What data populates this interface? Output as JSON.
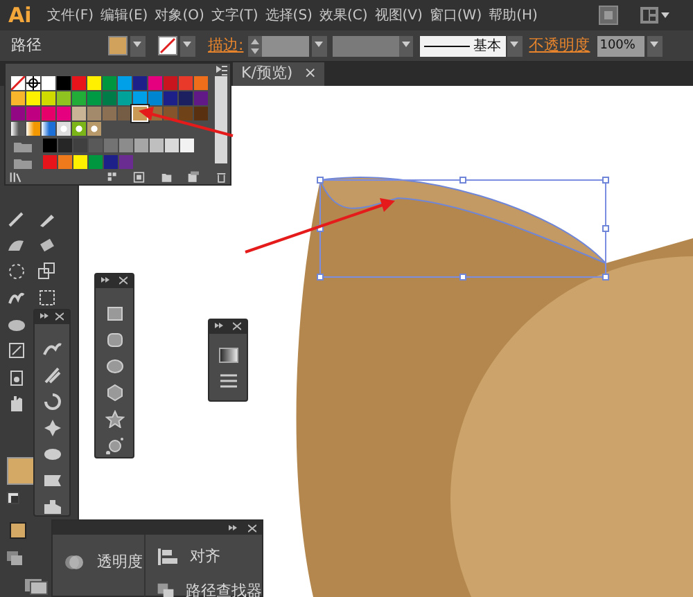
{
  "menu_bar": {
    "logo": "Ai",
    "menus": [
      "文件(F)",
      "编辑(E)",
      "对象(O)",
      "文字(T)",
      "选择(S)",
      "效果(C)",
      "视图(V)",
      "窗口(W)",
      "帮助(H)"
    ]
  },
  "control_bar": {
    "selection_type": "路径",
    "stroke_label": "描边:",
    "stroke_profile": "基本",
    "opacity_label": "不透明度",
    "opacity_value": "100%"
  },
  "document_tab": {
    "title": "K/预览)",
    "close": "×"
  },
  "swatches_panel": {
    "rows": [
      {
        "swatches": [
          {
            "kind": "none",
            "selected": false
          },
          {
            "kind": "registration",
            "selected": false
          },
          {
            "kind": "color",
            "color": "#ffffff",
            "selected": false
          },
          {
            "kind": "color",
            "color": "#000000",
            "selected": false
          },
          {
            "kind": "color",
            "color": "#e8141b",
            "selected": false
          },
          {
            "kind": "color",
            "color": "#fff000",
            "selected": false
          },
          {
            "kind": "color",
            "color": "#00953f",
            "selected": false
          },
          {
            "kind": "color",
            "color": "#00a0e9",
            "selected": false
          },
          {
            "kind": "color",
            "color": "#1d2088",
            "selected": false
          },
          {
            "kind": "color",
            "color": "#e4007f",
            "selected": false
          },
          {
            "kind": "color",
            "color": "#c9151e",
            "selected": false
          },
          {
            "kind": "color",
            "color": "#e8392a",
            "selected": false
          },
          {
            "kind": "color",
            "color": "#ef6e1b",
            "selected": false
          }
        ]
      },
      {
        "swatches": [
          {
            "kind": "color",
            "color": "#f8b62d",
            "selected": false
          },
          {
            "kind": "color",
            "color": "#fff100",
            "selected": false
          },
          {
            "kind": "color",
            "color": "#cfdb00",
            "selected": false
          },
          {
            "kind": "color",
            "color": "#8fc31f",
            "selected": false
          },
          {
            "kind": "color",
            "color": "#22ac38",
            "selected": false
          },
          {
            "kind": "color",
            "color": "#009944",
            "selected": false
          },
          {
            "kind": "color",
            "color": "#007c48",
            "selected": false
          },
          {
            "kind": "color",
            "color": "#00a29a",
            "selected": false
          },
          {
            "kind": "color",
            "color": "#00a0e9",
            "selected": false
          },
          {
            "kind": "color",
            "color": "#0086d1",
            "selected": false
          },
          {
            "kind": "color",
            "color": "#1d2088",
            "selected": false
          },
          {
            "kind": "color",
            "color": "#1d2060",
            "selected": false
          },
          {
            "kind": "color",
            "color": "#601986",
            "selected": false
          }
        ]
      },
      {
        "swatches": [
          {
            "kind": "color",
            "color": "#920783",
            "selected": false
          },
          {
            "kind": "color",
            "color": "#be0081",
            "selected": false
          },
          {
            "kind": "color",
            "color": "#e5006a",
            "selected": false
          },
          {
            "kind": "color",
            "color": "#e4007f",
            "selected": false
          },
          {
            "kind": "color",
            "color": "#c9b496",
            "selected": false
          },
          {
            "kind": "color",
            "color": "#a28a6b",
            "selected": false
          },
          {
            "kind": "color",
            "color": "#8c7054",
            "selected": false
          },
          {
            "kind": "color",
            "color": "#745c45",
            "selected": false
          },
          {
            "kind": "color",
            "color": "#c99a55",
            "selected": true
          },
          {
            "kind": "color",
            "color": "#9b6b3a",
            "selected": false
          },
          {
            "kind": "color",
            "color": "#86542a",
            "selected": false
          },
          {
            "kind": "color",
            "color": "#6f4218",
            "selected": false
          },
          {
            "kind": "color",
            "color": "#5a3110",
            "selected": false
          }
        ]
      },
      {
        "swatches": [
          {
            "kind": "gradient",
            "color": "#555555",
            "selected": false
          },
          {
            "kind": "gradient",
            "color": "#f39800",
            "selected": false
          },
          {
            "kind": "gradient",
            "color": "#1d6fd8",
            "selected": false
          },
          {
            "kind": "pattern",
            "color": "#dddddd",
            "selected": false
          },
          {
            "kind": "pattern",
            "color": "#7cb518",
            "selected": false
          },
          {
            "kind": "pattern",
            "color": "#b89a6a",
            "selected": false
          }
        ]
      },
      {
        "swatches": [
          {
            "kind": "folder",
            "selected": false
          },
          {
            "kind": "color",
            "color": "#000000",
            "selected": false
          },
          {
            "kind": "color",
            "color": "#262626",
            "selected": false
          },
          {
            "kind": "color",
            "color": "#404040",
            "selected": false
          },
          {
            "kind": "color",
            "color": "#595959",
            "selected": false
          },
          {
            "kind": "color",
            "color": "#737373",
            "selected": false
          },
          {
            "kind": "color",
            "color": "#8c8c8c",
            "selected": false
          },
          {
            "kind": "color",
            "color": "#a6a6a6",
            "selected": false
          },
          {
            "kind": "color",
            "color": "#bfbfbf",
            "selected": false
          },
          {
            "kind": "color",
            "color": "#d9d9d9",
            "selected": false
          },
          {
            "kind": "color",
            "color": "#f2f2f2",
            "selected": false
          }
        ]
      },
      {
        "swatches": [
          {
            "kind": "folder",
            "selected": false
          },
          {
            "kind": "color",
            "color": "#e8141b",
            "selected": false
          },
          {
            "kind": "color",
            "color": "#ef7a1b",
            "selected": false
          },
          {
            "kind": "color",
            "color": "#fff000",
            "selected": false
          },
          {
            "kind": "color",
            "color": "#00953f",
            "selected": false
          },
          {
            "kind": "color",
            "color": "#1d2088",
            "selected": false
          },
          {
            "kind": "color",
            "color": "#6a2c91",
            "selected": false
          }
        ]
      }
    ]
  },
  "dock_panels": [
    {
      "items": [
        {
          "label": "透明度"
        }
      ]
    },
    {
      "items": [
        {
          "label": "对齐"
        },
        {
          "label": "路径查找器"
        }
      ]
    }
  ]
}
